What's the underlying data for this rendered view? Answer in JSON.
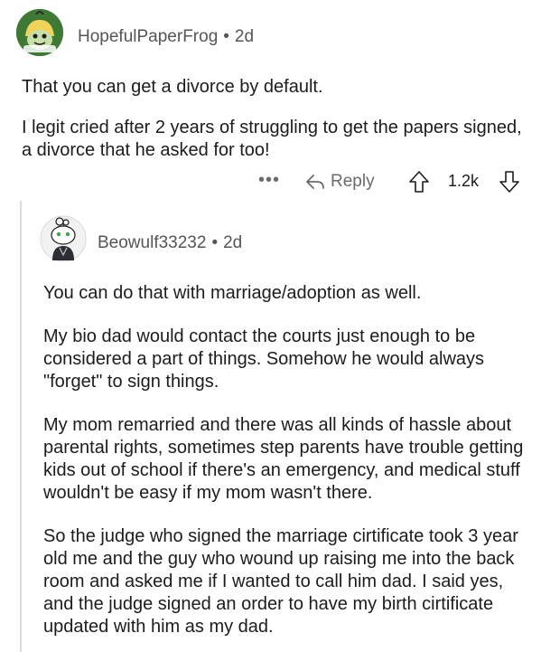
{
  "top_comment": {
    "username": "HopefulPaperFrog",
    "separator": "•",
    "age": "2d",
    "paragraphs": [
      "That you can get a divorce by default.",
      "I legit cried after 2 years of struggling to get the papers signed, a divorce that he asked for too!"
    ],
    "actions": {
      "more_label": "•••",
      "reply_label": "Reply",
      "vote_count": "1.2k"
    }
  },
  "reply_comment": {
    "username": "Beowulf33232",
    "separator": "•",
    "age": "2d",
    "paragraphs": [
      "You can do that with marriage/adoption as well.",
      "My bio dad would contact the courts just enough to be considered a part of things. Somehow he would always \"forget\" to sign things.",
      "My mom remarried and there was all kinds of hassle about parental rights, sometimes step parents have trouble getting kids out of school if there's an emergency, and medical stuff wouldn't be easy if my mom wasn't there.",
      "So the judge who signed the marriage cirtificate took 3 year old me and the guy who wound up raising me into the back room and asked me if I wanted to call him dad. I said yes, and the judge signed an order to have my birth cirtificate updated with him as my dad."
    ]
  },
  "icons": {
    "reply": "reply-arrow-icon",
    "upvote": "upvote-arrow-icon",
    "downvote": "downvote-arrow-icon",
    "more": "more-options-icon"
  },
  "colors": {
    "text": "#1c1c1c",
    "meta": "#555555",
    "action": "#6b6b6b",
    "thread_line": "#dcdcdc",
    "frog_avatar_bg": "#3f7a35"
  }
}
